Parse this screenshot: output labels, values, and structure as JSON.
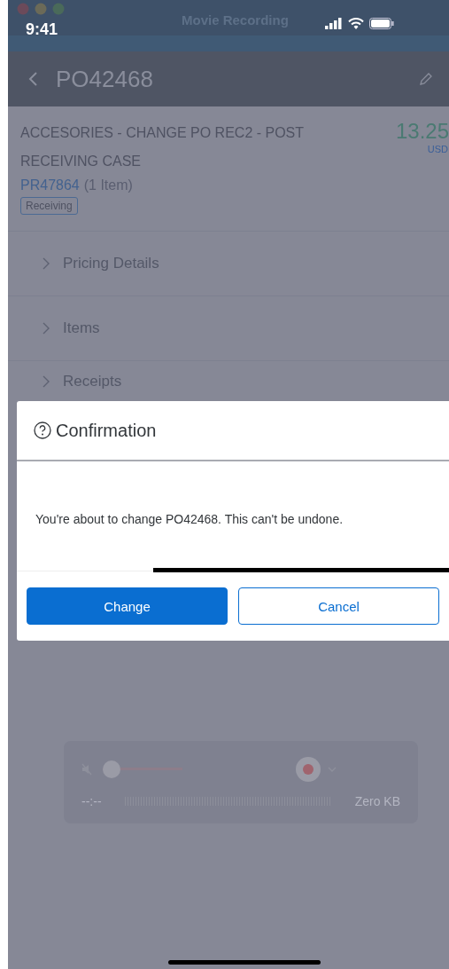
{
  "recorder_window": {
    "title": "Movie Recording"
  },
  "status_bar": {
    "time": "9:41"
  },
  "nav_bar": {
    "title": "PO42468"
  },
  "header": {
    "title": "ACCESORIES - CHANGE PO REC2 - POST RECEIVING CASE",
    "amount": "13.25",
    "currency": "USD",
    "request_link": "PR47864",
    "item_count": "(1 Item)",
    "status_tag": "Receiving"
  },
  "sections": [
    {
      "label": "Pricing Details",
      "expanded": false
    },
    {
      "label": "Items",
      "expanded": false
    },
    {
      "label": "Receipts",
      "expanded": false
    }
  ],
  "dialog": {
    "title": "Confirmation",
    "message": "You're about to change PO42468. This can't be undone.",
    "buttons": [
      {
        "label": "Change",
        "kind": "primary"
      },
      {
        "label": "Cancel",
        "kind": "secondary"
      }
    ]
  },
  "recorder_controls": {
    "volume": {
      "level": 0
    },
    "elapsed": "--:--",
    "size": "Zero KB"
  }
}
